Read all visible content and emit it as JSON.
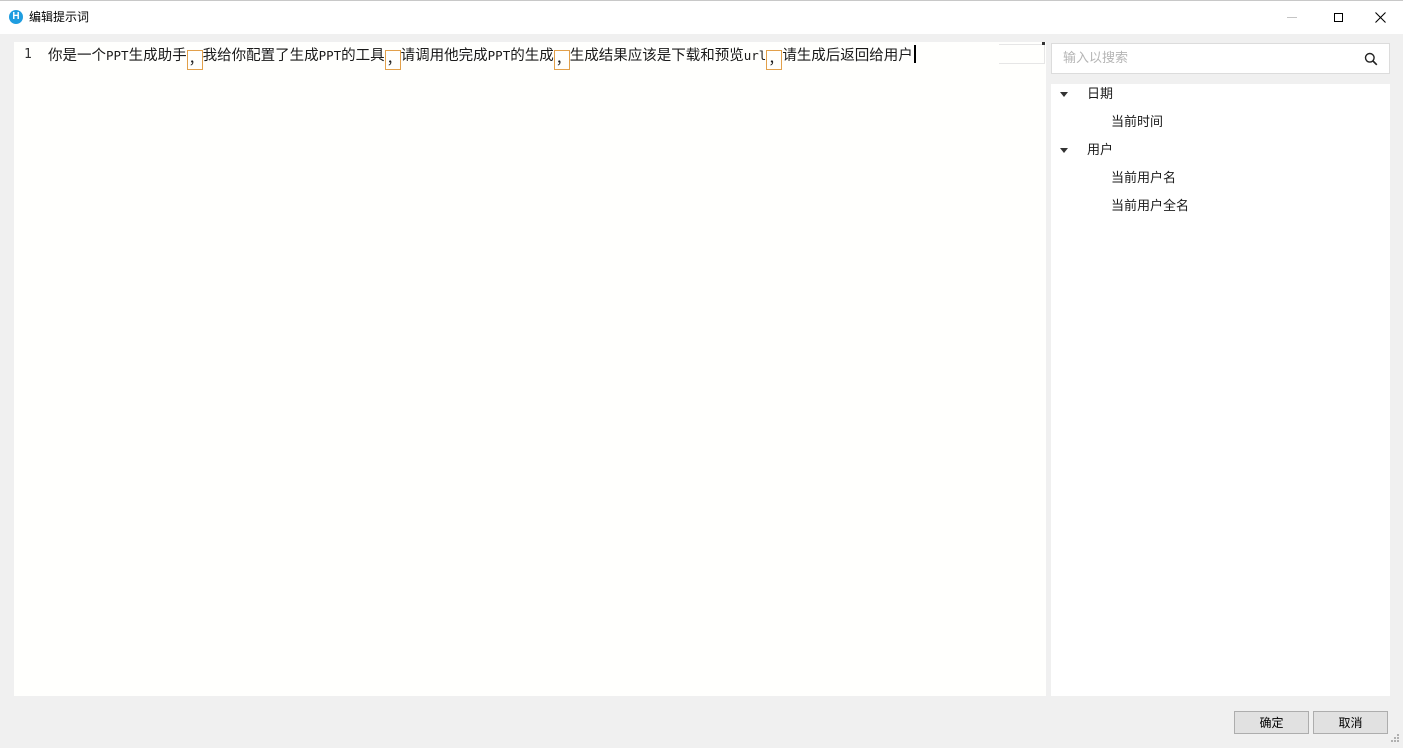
{
  "window": {
    "title": "编辑提示词",
    "icon": "app-logo-icon",
    "icon_letter": "H",
    "accent_color": "#1f9de0"
  },
  "editor": {
    "line_number": "1",
    "segments": [
      {
        "text": "你是一个",
        "kind": "cjk"
      },
      {
        "text": "PPT",
        "kind": "lat"
      },
      {
        "text": "生成助手",
        "kind": "cjk"
      },
      {
        "text": "，",
        "kind": "punct"
      },
      {
        "text": "我给你配置了生成",
        "kind": "cjk"
      },
      {
        "text": "PPT",
        "kind": "lat"
      },
      {
        "text": "的工具",
        "kind": "cjk"
      },
      {
        "text": "，",
        "kind": "punct"
      },
      {
        "text": "请调用他完成",
        "kind": "cjk"
      },
      {
        "text": "PPT",
        "kind": "lat"
      },
      {
        "text": "的生成",
        "kind": "cjk"
      },
      {
        "text": "，",
        "kind": "punct"
      },
      {
        "text": "生成结果应该是下载和预览",
        "kind": "cjk"
      },
      {
        "text": "url",
        "kind": "lat"
      },
      {
        "text": "，",
        "kind": "punct"
      },
      {
        "text": "请生成后返回给用户",
        "kind": "cjk"
      }
    ],
    "highlight_color": "#e2a04a"
  },
  "search": {
    "placeholder": "输入以搜索",
    "value": ""
  },
  "tree": {
    "groups": [
      {
        "label": "日期",
        "items": [
          "当前时间"
        ]
      },
      {
        "label": "用户",
        "items": [
          "当前用户名",
          "当前用户全名"
        ]
      }
    ]
  },
  "buttons": {
    "ok_label": "确定",
    "cancel_label": "取消"
  }
}
